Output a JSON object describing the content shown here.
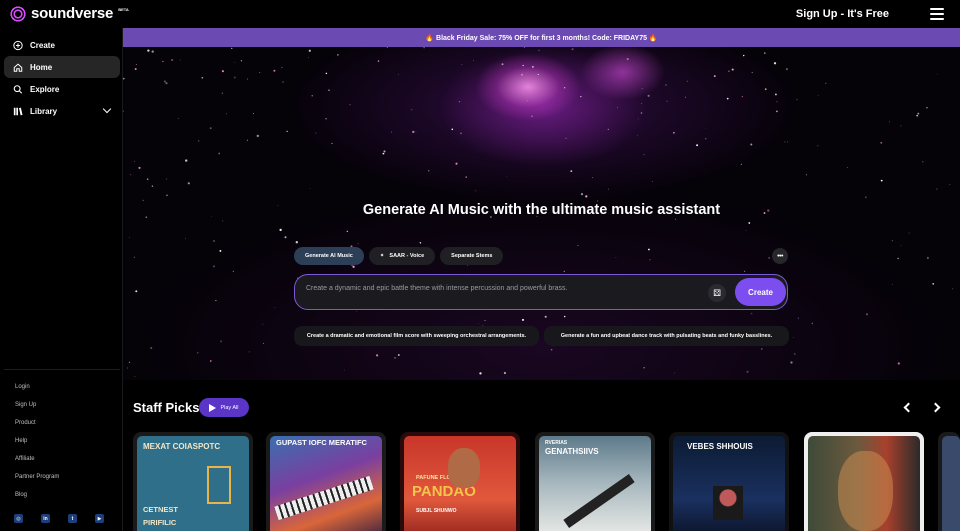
{
  "app": {
    "logo_text": "soundverse",
    "logo_badge": "BETA",
    "signup_label": "Sign Up - It's Free"
  },
  "sidebar": {
    "items": [
      {
        "label": "Create",
        "icon": "plus-circle-icon"
      },
      {
        "label": "Home",
        "icon": "home-icon",
        "active": true
      },
      {
        "label": "Explore",
        "icon": "search-icon"
      },
      {
        "label": "Library",
        "icon": "library-icon"
      }
    ],
    "footer_links": [
      "Login",
      "Sign Up",
      "Product",
      "Help",
      "Affiliate",
      "Partner Program",
      "Blog"
    ],
    "socials": [
      "instagram-icon",
      "linkedin-icon",
      "twitter-icon",
      "youtube-icon"
    ]
  },
  "promo": {
    "text": "🔥 Black Friday Sale: 75% OFF for first 3 months! Code: FRIDAY75 🔥"
  },
  "hero": {
    "title": "Generate AI Music with the ultimate music assistant",
    "tabs": [
      {
        "label": "Generate AI Music",
        "active": true
      },
      {
        "label": "SAAR - Voice",
        "icon": "sparkle-icon"
      },
      {
        "label": "Separate Stems"
      }
    ],
    "more_label": "•••",
    "prompt_placeholder": "Create a dynamic and epic battle theme with intense percussion and powerful brass.",
    "create_label": "Create",
    "suggestions": [
      "Create a dramatic and emotional film score with sweeping orchestral arrangements.",
      "Generate a fun and upbeat dance track with pulsating beats and funky basslines."
    ]
  },
  "staff_picks": {
    "title": "Staff Picks",
    "play_all_label": "Play All",
    "cards": [
      {
        "title": "MEXAT COIASPOTC",
        "subtitle": "CETNEST PIRIFILIC"
      },
      {
        "title": "GUPAST IOFC MERATIFC",
        "subtitle": ""
      },
      {
        "title": "PANDAO",
        "subtitle": "PAFUNE FLOR",
        "caption": "SUBJL SHUNWO"
      },
      {
        "title": "GENATHSIIVS",
        "subtitle": "RVERIAS"
      },
      {
        "title": "VEBES SHHOUIS",
        "subtitle": ""
      },
      {
        "title": "",
        "subtitle": ""
      }
    ]
  },
  "colors": {
    "accent": "#7c4ef0",
    "promo": "#6b4ab2",
    "background": "#000000"
  }
}
